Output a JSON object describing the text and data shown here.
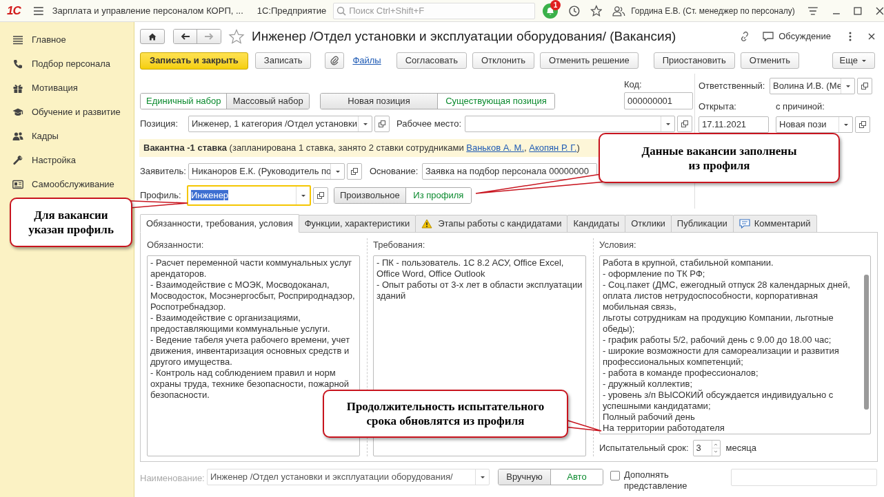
{
  "app_bar": {
    "logo": "1С",
    "title": "Зарплата и управление персоналом КОРП, ...",
    "platform": "1С:Предприятие",
    "search": {
      "placeholder": "Поиск Ctrl+Shift+F"
    },
    "notification_count": "1",
    "user": "Гордина Е.В. (Ст. менеджер по персоналу)"
  },
  "sidebar": {
    "items": [
      {
        "label": "Главное"
      },
      {
        "label": "Подбор персонала"
      },
      {
        "label": "Мотивация"
      },
      {
        "label": "Обучение и развитие"
      },
      {
        "label": "Кадры"
      },
      {
        "label": "Настройка"
      },
      {
        "label": "Самообслуживание"
      }
    ]
  },
  "form": {
    "title": "Инженер /Отдел установки и эксплуатации оборудования/ (Вакансия)",
    "discussion": "Обсуждение",
    "toolbar": {
      "save_close": "Записать и закрыть",
      "save": "Записать",
      "files": "Файлы",
      "actions": [
        "Согласовать",
        "Отклонить",
        "Отменить решение"
      ],
      "actions2": [
        "Приостановить",
        "Отменить"
      ],
      "more": "Еще"
    },
    "recruitment_type": [
      {
        "label": "Единичный набор",
        "selected": true
      },
      {
        "label": "Массовый набор",
        "selected": false
      }
    ],
    "position_type": [
      {
        "label": "Новая позиция",
        "selected": false
      },
      {
        "label": "Существующая позиция",
        "selected": true
      }
    ],
    "code": {
      "label": "Код:",
      "value": "000000001"
    },
    "responsible": {
      "label": "Ответственный:",
      "value": "Волина И.В. (Ме"
    },
    "opened": {
      "label": "Открыта:",
      "value": "17.11.2021"
    },
    "reason": {
      "label": "с причиной:",
      "value": "Новая пози"
    },
    "position": {
      "label": "Позиция:",
      "value": "Инженер, 1 категория /Отдел установки"
    },
    "workplace": {
      "label": "Рабочее место:"
    },
    "status": {
      "text": "**Вакантна -1 ставка** (запланирована 1 ставка, занято 2 ставки сотрудниками ",
      "links": [
        "Ваньков А. М.",
        "Акопян Р. Г."
      ],
      "separator": ", ",
      "suffix": ")"
    },
    "applicant": {
      "label": "Заявитель:",
      "value": "Никаноров Е.К. (Руководитель по"
    },
    "basis": {
      "label": "Основание:",
      "value": "Заявка на подбор персонала 00000000"
    },
    "profile": {
      "label": "Профиль:",
      "value": "Инженер"
    },
    "profile_mode": [
      {
        "label": "Произвольное",
        "selected": false
      },
      {
        "label": "Из профиля",
        "selected": true
      }
    ],
    "tabs": [
      {
        "label": "Обязанности, требования, условия",
        "kind": "plain",
        "selected": true
      },
      {
        "label": "Функции, характеристики",
        "kind": "plain",
        "selected": false
      },
      {
        "label": "Этапы работы с кандидатами",
        "kind": "warning",
        "selected": false
      },
      {
        "label": "Кандидаты",
        "kind": "plain",
        "selected": false
      },
      {
        "label": "Отклики",
        "kind": "plain",
        "selected": false
      },
      {
        "label": "Публикации",
        "kind": "plain",
        "selected": false
      },
      {
        "label": "Комментарий",
        "kind": "comment",
        "selected": false
      }
    ],
    "columns": [
      {
        "label": "Обязанности:",
        "text": "- Расчет переменной части коммунальных услуг арендаторов.\n- Взаимодействие с МОЭК, Мосводоканал, Мосводосток, Мосэнергосбыт, Росприроднадзор, Роспотребнадзор.\n- Взаимодействие с организациями, предоставляющими коммунальные услуги.\n- Ведение табеля учета рабочего времени, учет движения, инвентаризация основных средств и другого имущества.\n- Контроль над соблюдением правил и норм охраны труда, технике безопасности, пожарной безопасности."
      },
      {
        "label": "Требования:",
        "text": "- ПК - пользователь. 1С 8.2 АСУ, Office Excel, Office Word, Office Outlook\n- Опыт работы от 3-х лет в области эксплуатации зданий"
      },
      {
        "label": "Условия:",
        "text": " Работа в крупной, стабильной компании.\n- оформление по ТК РФ;\n- Соц.пакет (ДМС, ежегодный отпуск 28 календарных дней, оплата листов нетрудоспособности, корпоративная мобильная связь,\nльготы сотрудникам на продукцию Компании, льготные обеды);\n- график работы 5/2, рабочий день с 9.00 до 18.00 час;\n- широкие возможности для самореализации и развития профессиональных компетенций;\n- работа в команде профессионалов;\n- дружный коллектив;\n- уровень з/п ВЫСОКИЙ обсуждается индивидуально с успешными кандидатами;\nПолный рабочий день\nНа территории работодателя"
      }
    ],
    "probation": {
      "label": "Испытательный срок:",
      "value": "3",
      "unit": "месяца"
    },
    "name": {
      "label": "Наименование:",
      "value": "Инженер /Отдел установки и эксплуатации оборудования/"
    },
    "name_mode": [
      {
        "label": "Вручную",
        "selected": false
      },
      {
        "label": "Авто",
        "selected": true
      }
    ],
    "extend": {
      "label": "Дополнять представление",
      "checked": false
    }
  },
  "callouts": [
    {
      "text": "Данные вакансии заполнены\nиз профиля"
    },
    {
      "text": "Для вакансии\nуказан профиль"
    },
    {
      "text": "Продолжительность испытательного\nсрока обновлятся из профиля"
    }
  ]
}
